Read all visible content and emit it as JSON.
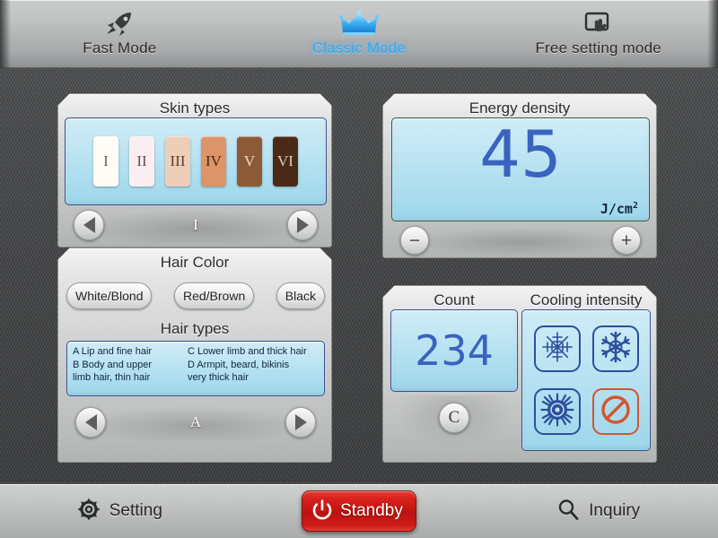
{
  "topbar": {
    "tabs": [
      {
        "id": "fast",
        "label": "Fast Mode",
        "icon": "rocket-icon",
        "active": false
      },
      {
        "id": "classic",
        "label": "Classic Mode",
        "icon": "crown-icon",
        "active": true
      },
      {
        "id": "free",
        "label": "Free setting mode",
        "icon": "touch-screen-icon",
        "active": false
      }
    ],
    "active_tab_color": "#2fa9f5"
  },
  "skin_types": {
    "title": "Skin types",
    "selected": "I",
    "swatches": [
      {
        "label": "I",
        "bg": "#fdfcf7",
        "fg": "#6b6a3c"
      },
      {
        "label": "II",
        "bg": "#fbeef0",
        "fg": "#6b4a47"
      },
      {
        "label": "III",
        "bg": "#edceb8",
        "fg": "#5a3a2a"
      },
      {
        "label": "IV",
        "bg": "#dd9468",
        "fg": "#4a2512"
      },
      {
        "label": "V",
        "bg": "#8d5a38",
        "fg": "#efd9c5"
      },
      {
        "label": "VI",
        "bg": "#4a2a17",
        "fg": "#e2cfbf"
      }
    ],
    "prev_label": "previous",
    "next_label": "next"
  },
  "hair": {
    "color_title": "Hair Color",
    "colors": [
      {
        "label": "White/Blond"
      },
      {
        "label": "Red/Brown"
      },
      {
        "label": "Black"
      }
    ],
    "types_title": "Hair types",
    "types": [
      {
        "key": "A",
        "text": "A Lip and fine hair"
      },
      {
        "key": "C",
        "text": "C Lower limb and thick hair"
      },
      {
        "key": "B",
        "text": "B Body and upper\n   limb hair, thin hair"
      },
      {
        "key": "D",
        "text": "D Armpit, beard, bikinis\n     very thick hair"
      }
    ],
    "selected": "A",
    "prev_label": "previous",
    "next_label": "next"
  },
  "energy": {
    "title": "Energy density",
    "value": "45",
    "unit_base": "J/cm",
    "unit_exp": "2",
    "minus_label": "−",
    "plus_label": "+"
  },
  "count": {
    "title": "Count",
    "value": "234",
    "clear_label": "C"
  },
  "cooling": {
    "title": "Cooling intensity",
    "options": [
      {
        "id": "low",
        "icon": "snowflake-low-icon",
        "state": "on"
      },
      {
        "id": "medium",
        "icon": "snowflake-medium-icon",
        "state": "on"
      },
      {
        "id": "high",
        "icon": "snowflake-high-icon",
        "state": "on"
      },
      {
        "id": "off",
        "icon": "prohibited-icon",
        "state": "off"
      }
    ],
    "on_color": "#2c4f9c",
    "off_color": "#d2552f"
  },
  "bottombar": {
    "setting_label": "Setting",
    "standby_label": "Standby",
    "inquiry_label": "Inquiry",
    "standby_color": "#c81813"
  }
}
